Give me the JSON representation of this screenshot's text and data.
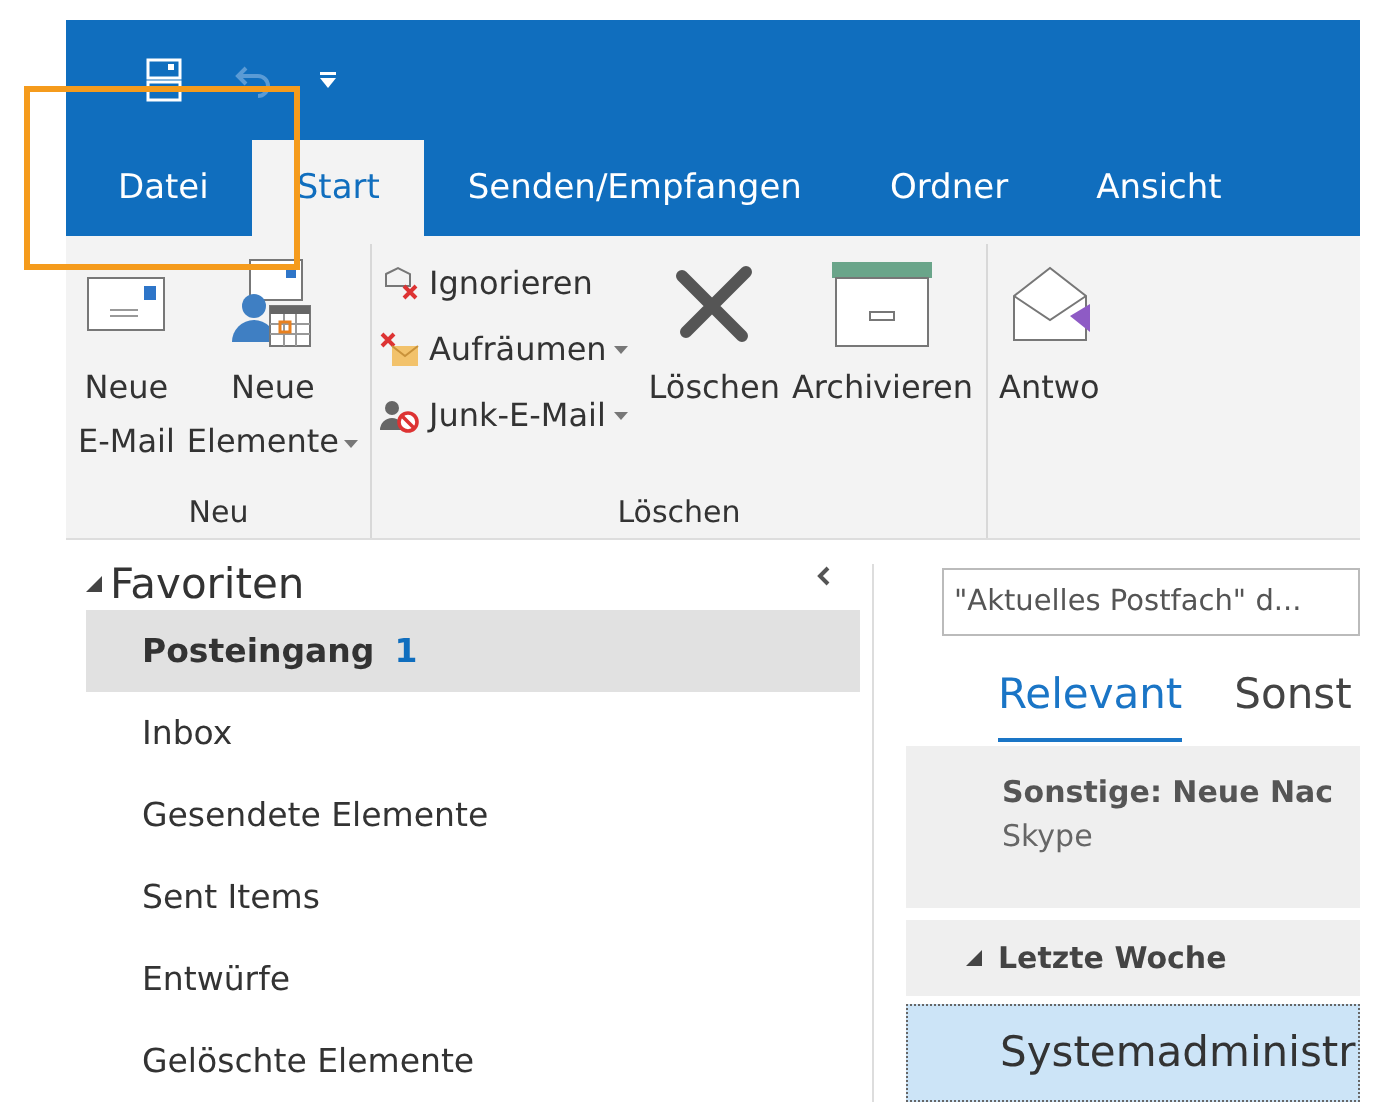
{
  "ribbon_tabs": [
    {
      "label": "Datei",
      "selected": false
    },
    {
      "label": "Start",
      "selected": true
    },
    {
      "label": "Senden/Empfangen",
      "selected": false
    },
    {
      "label": "Ordner",
      "selected": false
    },
    {
      "label": "Ansicht",
      "selected": false
    }
  ],
  "ribbon_groups": [
    {
      "label": "Neu",
      "buttons": [
        {
          "kind": "large",
          "lines": [
            "Neue",
            "E-Mail"
          ],
          "dropdown": false
        },
        {
          "kind": "large",
          "lines": [
            "Neue",
            "Elemente"
          ],
          "dropdown": true
        }
      ]
    },
    {
      "label": "Löschen",
      "buttons": [
        {
          "kind": "small",
          "lines": [
            "Ignorieren"
          ],
          "dropdown": false
        },
        {
          "kind": "small",
          "lines": [
            "Aufräumen"
          ],
          "dropdown": true
        },
        {
          "kind": "small",
          "lines": [
            "Junk-E-Mail"
          ],
          "dropdown": true
        },
        {
          "kind": "large",
          "lines": [
            "Löschen"
          ],
          "dropdown": false
        },
        {
          "kind": "large",
          "lines": [
            "Archivieren"
          ],
          "dropdown": false
        }
      ]
    },
    {
      "buttons": [
        {
          "kind": "large",
          "lines": [
            "Antwo"
          ],
          "dropdown": false
        }
      ]
    }
  ],
  "folder_pane": {
    "header": "Favoriten",
    "expanded": true,
    "folders": [
      {
        "name": "Posteingang",
        "count": "1",
        "selected": true
      },
      {
        "name": "Inbox",
        "selected": false
      },
      {
        "name": "Gesendete Elemente",
        "selected": false
      },
      {
        "name": "Sent Items",
        "selected": false
      },
      {
        "name": "Entwürfe",
        "selected": false
      },
      {
        "name": "Gelöschte Elemente",
        "selected": false
      }
    ]
  },
  "message_list": {
    "search_placeholder": "\"Aktuelles Postfach\" d...",
    "view_tabs": [
      {
        "label": "Relevant",
        "selected": true
      },
      {
        "label": "Sonst",
        "selected": false
      }
    ],
    "notice": {
      "title": "Sonstige: Neue Nac",
      "sender": "Skype"
    },
    "group": {
      "label": "Letzte Woche",
      "expanded": true
    },
    "messages": [
      {
        "sender": "Systemadministr",
        "selected": true
      }
    ]
  }
}
